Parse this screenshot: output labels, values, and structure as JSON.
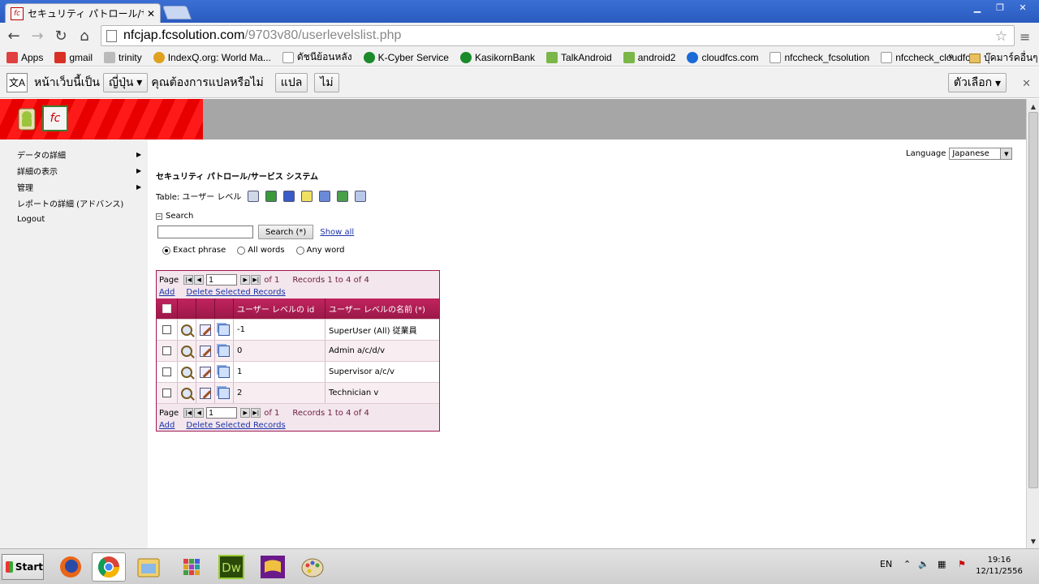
{
  "browser": {
    "tab_title": "セキュリティ パトロール/サ",
    "tab_close": "✕",
    "url_host": "nfcjap.fcsolution.com",
    "url_path": "/9703v80/userlevelslist.php",
    "bookmarks": [
      {
        "label": "Apps",
        "color": "#e04040"
      },
      {
        "label": "gmail",
        "color": "#d93025"
      },
      {
        "label": "trinity",
        "color": "#888888"
      },
      {
        "label": "IndexQ.org: World Ma...",
        "color": "#e0a020"
      },
      {
        "label": "ดัชนีย้อนหลัง",
        "color": "#999999"
      },
      {
        "label": "K-Cyber Service",
        "color": "#1a8a2a"
      },
      {
        "label": "KasikornBank",
        "color": "#1a8a2a"
      },
      {
        "label": "TalkAndroid",
        "color": "#7ab648"
      },
      {
        "label": "android2",
        "color": "#7ab648"
      },
      {
        "label": "cloudfcs.com",
        "color": "#1a6ad8"
      },
      {
        "label": "nfccheck_fcsolution",
        "color": "#999999"
      },
      {
        "label": "nfccheck_cloudfcs",
        "color": "#999999"
      }
    ],
    "bookmarks_more": "»",
    "other_bookmarks": "บุ๊คมาร์คอื่นๆ"
  },
  "translate": {
    "prefix": "หน้าเว็บนี้เป็น",
    "language": "ญี่ปุ่น",
    "question": "คุณต้องการแปลหรือไม่",
    "translate_button": "แปล",
    "no_button": "ไม่",
    "options_button": "ตัวเลือก"
  },
  "sidebar": {
    "items": [
      {
        "label": "データの詳細",
        "arrow": "▶"
      },
      {
        "label": "詳細の表示",
        "arrow": "▶"
      },
      {
        "label": "管理",
        "arrow": "▶"
      },
      {
        "label": "レポートの詳細 (アドバンス)",
        "arrow": ""
      },
      {
        "label": "Logout",
        "arrow": ""
      }
    ]
  },
  "content": {
    "language_label": "Language",
    "language_value": "Japanese",
    "system_title": "セキュリティ パトロール/サービス システム",
    "table_label": "Table: ユーザー レベル",
    "search_label": "Search",
    "search_value": "",
    "search_button": "Search (*)",
    "show_all": "Show all",
    "radio": {
      "exact": "Exact phrase",
      "all": "All words",
      "any": "Any word"
    }
  },
  "grid": {
    "pager": {
      "page_label": "Page",
      "page_value": "1",
      "of_label": "of 1",
      "records": "Records 1 to 4 of 4",
      "add": "Add",
      "delete": "Delete Selected Records"
    },
    "columns": {
      "id": "ユーザー レベルの id",
      "name": "ユーザー レベルの名前 (*)"
    },
    "rows": [
      {
        "id": "-1",
        "name": "SuperUser (All) 従業員"
      },
      {
        "id": "0",
        "name": "Admin a/c/d/v"
      },
      {
        "id": "1",
        "name": "Supervisor a/c/v"
      },
      {
        "id": "2",
        "name": "Technician v"
      }
    ]
  },
  "taskbar": {
    "start": "Start",
    "lang": "EN",
    "time": "19:16",
    "date": "12/11/2556"
  }
}
